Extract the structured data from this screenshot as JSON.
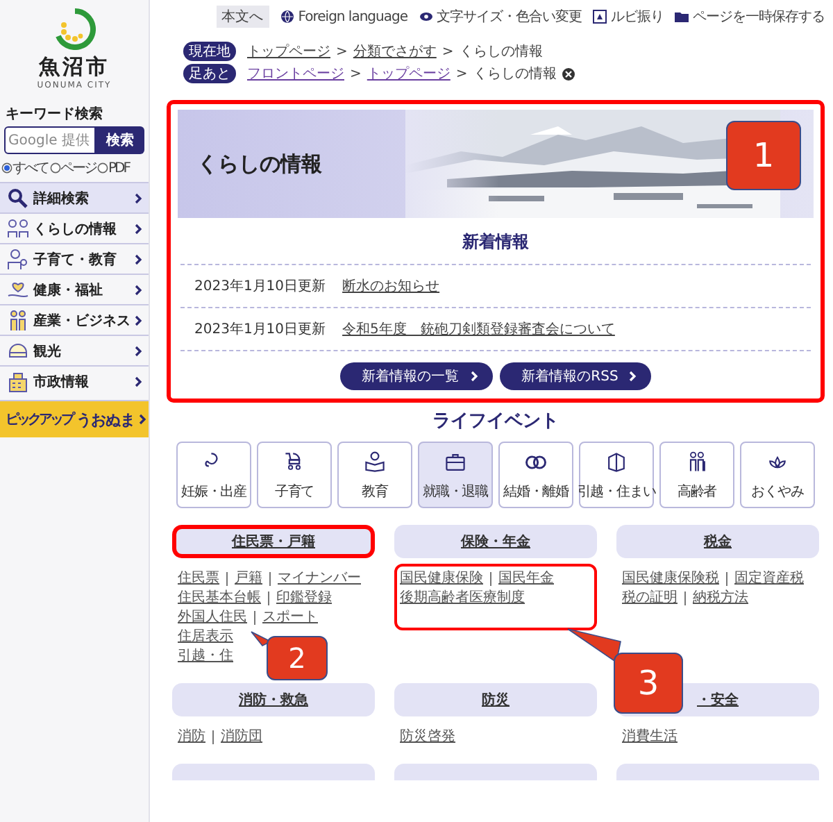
{
  "topbar": {
    "skip": "本文へ",
    "links": [
      "Foreign language",
      "文字サイズ・色合い変更",
      "ルビ振り",
      "ページを一時保存する"
    ]
  },
  "sidebar": {
    "logo": {
      "name": "魚沼市",
      "roman": "UONUMA CITY"
    },
    "search": {
      "heading": "キーワード検索",
      "placeholder": "Google 提供",
      "button": "検索",
      "scopes": [
        {
          "label": "すべて",
          "selected": true
        },
        {
          "label": "ページ",
          "selected": false
        },
        {
          "label": "PDF",
          "selected": false
        }
      ]
    },
    "menu": [
      {
        "label": "詳細検索",
        "kind": "search"
      },
      {
        "label": "くらしの情報",
        "kind": "category"
      },
      {
        "label": "子育て・教育",
        "kind": "category"
      },
      {
        "label": "健康・福祉",
        "kind": "category"
      },
      {
        "label": "産業・ビジネス",
        "kind": "category"
      },
      {
        "label": "観光",
        "kind": "category"
      },
      {
        "label": "市政情報",
        "kind": "category"
      }
    ],
    "banner": {
      "label": "ピックアップ",
      "title": "うおぬま"
    }
  },
  "breadcrumbs": [
    {
      "badge": "現在地",
      "separator": ">",
      "clearable": false,
      "items": [
        {
          "label": "トップページ",
          "link": true
        },
        {
          "label": "分類でさがす",
          "link": true
        },
        {
          "label": "くらしの情報",
          "link": false
        }
      ]
    },
    {
      "badge": "足あと",
      "separator": ">",
      "clearable": true,
      "items": [
        {
          "label": "フロントページ",
          "link": true
        },
        {
          "label": "トップページ",
          "link": true
        },
        {
          "label": "くらしの情報",
          "link": false
        }
      ]
    }
  ],
  "hero": {
    "title": "くらしの情報"
  },
  "news": {
    "heading": "新着情報",
    "highlighted": true,
    "items": [
      {
        "date": "2023年1月10日更新",
        "title": "断水のお知らせ"
      },
      {
        "date": "2023年1月10日更新",
        "title": "令和5年度　銃砲刀剣類登録審査会について"
      }
    ],
    "buttons": [
      "新着情報の一覧",
      "新着情報のRSS"
    ]
  },
  "life_events": {
    "heading": "ライフイベント",
    "items": [
      {
        "label": "妊娠・出産",
        "selected": false
      },
      {
        "label": "子育て",
        "selected": false
      },
      {
        "label": "教育",
        "selected": false
      },
      {
        "label": "就職・退職",
        "selected": true
      },
      {
        "label": "結婚・離婚",
        "selected": false
      },
      {
        "label": "引越・住まい",
        "selected": false
      },
      {
        "label": "高齢者",
        "selected": false
      },
      {
        "label": "おくやみ",
        "selected": false
      }
    ]
  },
  "categories": [
    {
      "kind": "group",
      "title": "住民票・戸籍",
      "highlighted": true,
      "links_highlighted": false,
      "lines": [
        [
          "住民票",
          "戸籍",
          "マイナンバー"
        ],
        [
          "住民基本台帳",
          "印鑑登録"
        ],
        [
          "外国人住民",
          "スポート"
        ],
        [
          "住居表示"
        ],
        [
          "引越・住"
        ]
      ]
    },
    {
      "kind": "group",
      "title": "保険・年金",
      "highlighted": false,
      "links_highlighted": true,
      "lines": [
        [
          "国民健康保険",
          "国民年金"
        ],
        [
          "後期高齢者医療制度"
        ]
      ]
    },
    {
      "kind": "group",
      "title": "税金",
      "highlighted": false,
      "links_highlighted": false,
      "lines": [
        [
          "国民健康保険税",
          "固定資産税"
        ],
        [
          "税の証明",
          "納税方法"
        ]
      ]
    },
    {
      "kind": "group",
      "title": "消防・救急",
      "highlighted": false,
      "links_highlighted": false,
      "lines": [
        [
          "消防",
          "消防団"
        ]
      ]
    },
    {
      "kind": "group",
      "title": "防災",
      "highlighted": false,
      "links_highlighted": false,
      "lines": [
        [
          "防災啓発"
        ]
      ]
    },
    {
      "kind": "group",
      "title": "・安全",
      "highlighted": false,
      "links_highlighted": false,
      "lines": [
        [
          "消費生活"
        ]
      ]
    },
    {
      "kind": "cut"
    },
    {
      "kind": "cut"
    },
    {
      "kind": "cut"
    }
  ],
  "callouts": [
    {
      "label": "1"
    },
    {
      "label": "2"
    },
    {
      "label": "3"
    }
  ]
}
